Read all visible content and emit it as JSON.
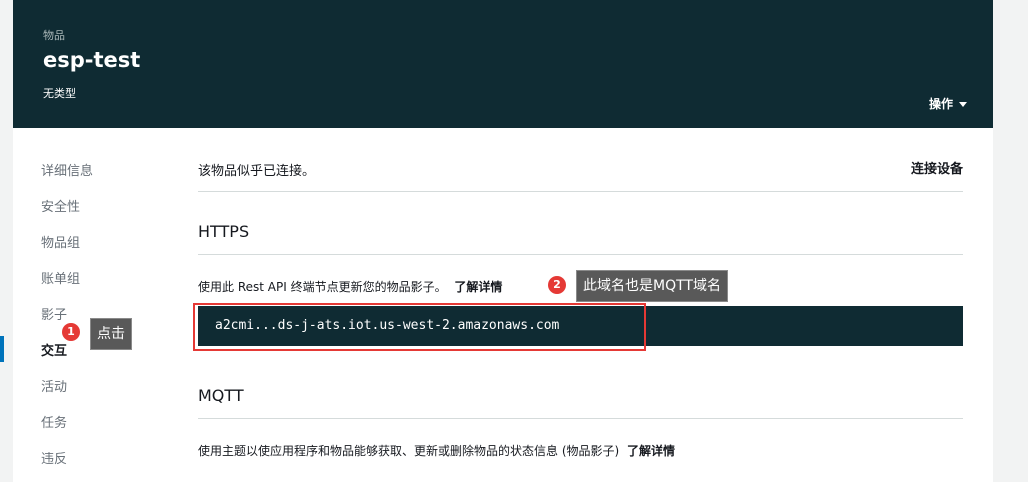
{
  "header": {
    "breadcrumb": "物品",
    "title": "esp-test",
    "subtitle": "无类型",
    "actions_label": "操作"
  },
  "nav": {
    "items": [
      {
        "label": "详细信息"
      },
      {
        "label": "安全性"
      },
      {
        "label": "物品组"
      },
      {
        "label": "账单组"
      },
      {
        "label": "影子"
      },
      {
        "label": "交互",
        "active": true
      },
      {
        "label": "活动"
      },
      {
        "label": "任务"
      },
      {
        "label": "违反"
      }
    ]
  },
  "main": {
    "status_text": "该物品似乎已连接。",
    "connect_label": "连接设备",
    "https": {
      "heading": "HTTPS",
      "description": "使用此 Rest API 终端节点更新您的物品影子。",
      "learn_more": "了解详情",
      "endpoint": "a2cmi...ds-j-ats.iot.us-west-2.amazonaws.com"
    },
    "mqtt": {
      "heading": "MQTT",
      "description": "使用主题以使应用程序和物品能够获取、更新或删除物品的状态信息 (物品影子)",
      "learn_more": "了解详情"
    }
  },
  "annotations": {
    "badge1": "1",
    "callout1": "点击",
    "badge2": "2",
    "callout2": "此域名也是MQTT域名",
    "color": "#e53935"
  }
}
